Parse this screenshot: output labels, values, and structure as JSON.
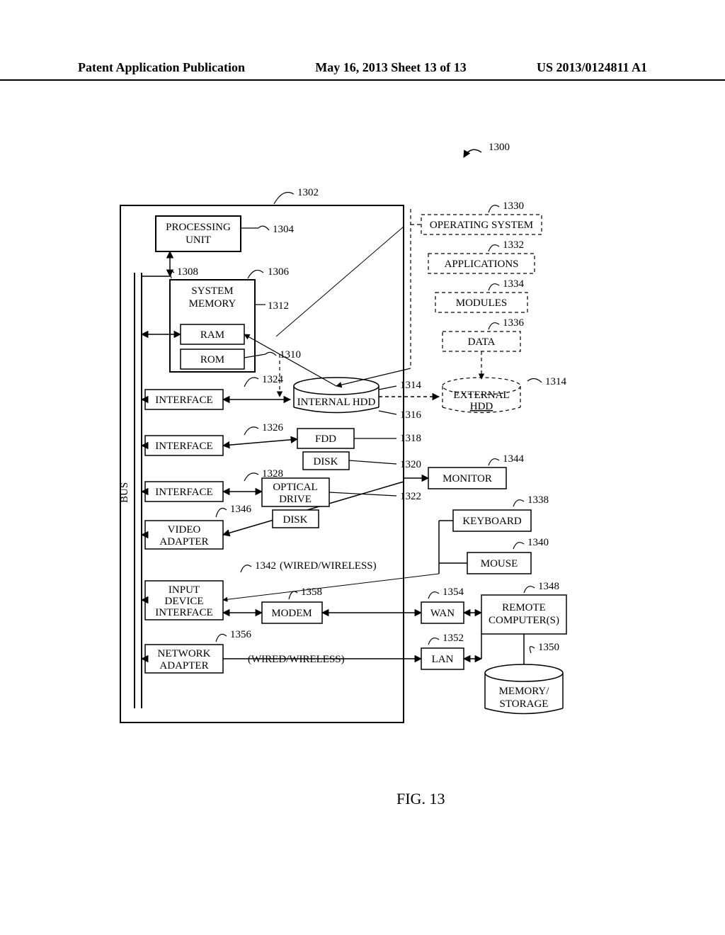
{
  "header": {
    "left": "Patent Application Publication",
    "middle": "May 16, 2013  Sheet 13 of 13",
    "right": "US 2013/0124811 A1"
  },
  "figure_label": "FIG. 13",
  "refs": {
    "r1300": "1300",
    "r1302": "1302",
    "r1304": "1304",
    "r1306": "1306",
    "r1308": "1308",
    "r1310": "1310",
    "r1312": "1312",
    "r1314": "1314",
    "r1314b": "1314",
    "r1316": "1316",
    "r1318": "1318",
    "r1320": "1320",
    "r1322": "1322",
    "r1324": "1324",
    "r1326": "1326",
    "r1328": "1328",
    "r1330": "1330",
    "r1332": "1332",
    "r1334": "1334",
    "r1336": "1336",
    "r1338": "1338",
    "r1340": "1340",
    "r1342": "1342",
    "r1344": "1344",
    "r1346": "1346",
    "r1348": "1348",
    "r1350": "1350",
    "r1352": "1352",
    "r1354": "1354",
    "r1356": "1356",
    "r1358": "1358"
  },
  "labels": {
    "processing_unit1": "PROCESSING",
    "processing_unit2": "UNIT",
    "system_memory1": "SYSTEM",
    "system_memory2": "MEMORY",
    "ram": "RAM",
    "rom": "ROM",
    "interface": "INTERFACE",
    "internal_hdd": "INTERNAL HDD",
    "external1": "EXTERNAL",
    "external2": "HDD",
    "fdd": "FDD",
    "disk": "DISK",
    "optical1": "OPTICAL",
    "optical2": "DRIVE",
    "video1": "VIDEO",
    "video2": "ADAPTER",
    "input1": "INPUT",
    "input2": "DEVICE",
    "input3": "INTERFACE",
    "modem": "MODEM",
    "network1": "NETWORK",
    "network2": "ADAPTER",
    "bus": "BUS",
    "operating_system": "OPERATING SYSTEM",
    "applications": "APPLICATIONS",
    "modules": "MODULES",
    "data": "DATA",
    "monitor": "MONITOR",
    "keyboard": "KEYBOARD",
    "mouse": "MOUSE",
    "wan": "WAN",
    "lan": "LAN",
    "remote1": "REMOTE",
    "remote2": "COMPUTER(S)",
    "memory1": "MEMORY/",
    "memory2": "STORAGE",
    "wired_wireless": "(WIRED/WIRELESS)"
  }
}
